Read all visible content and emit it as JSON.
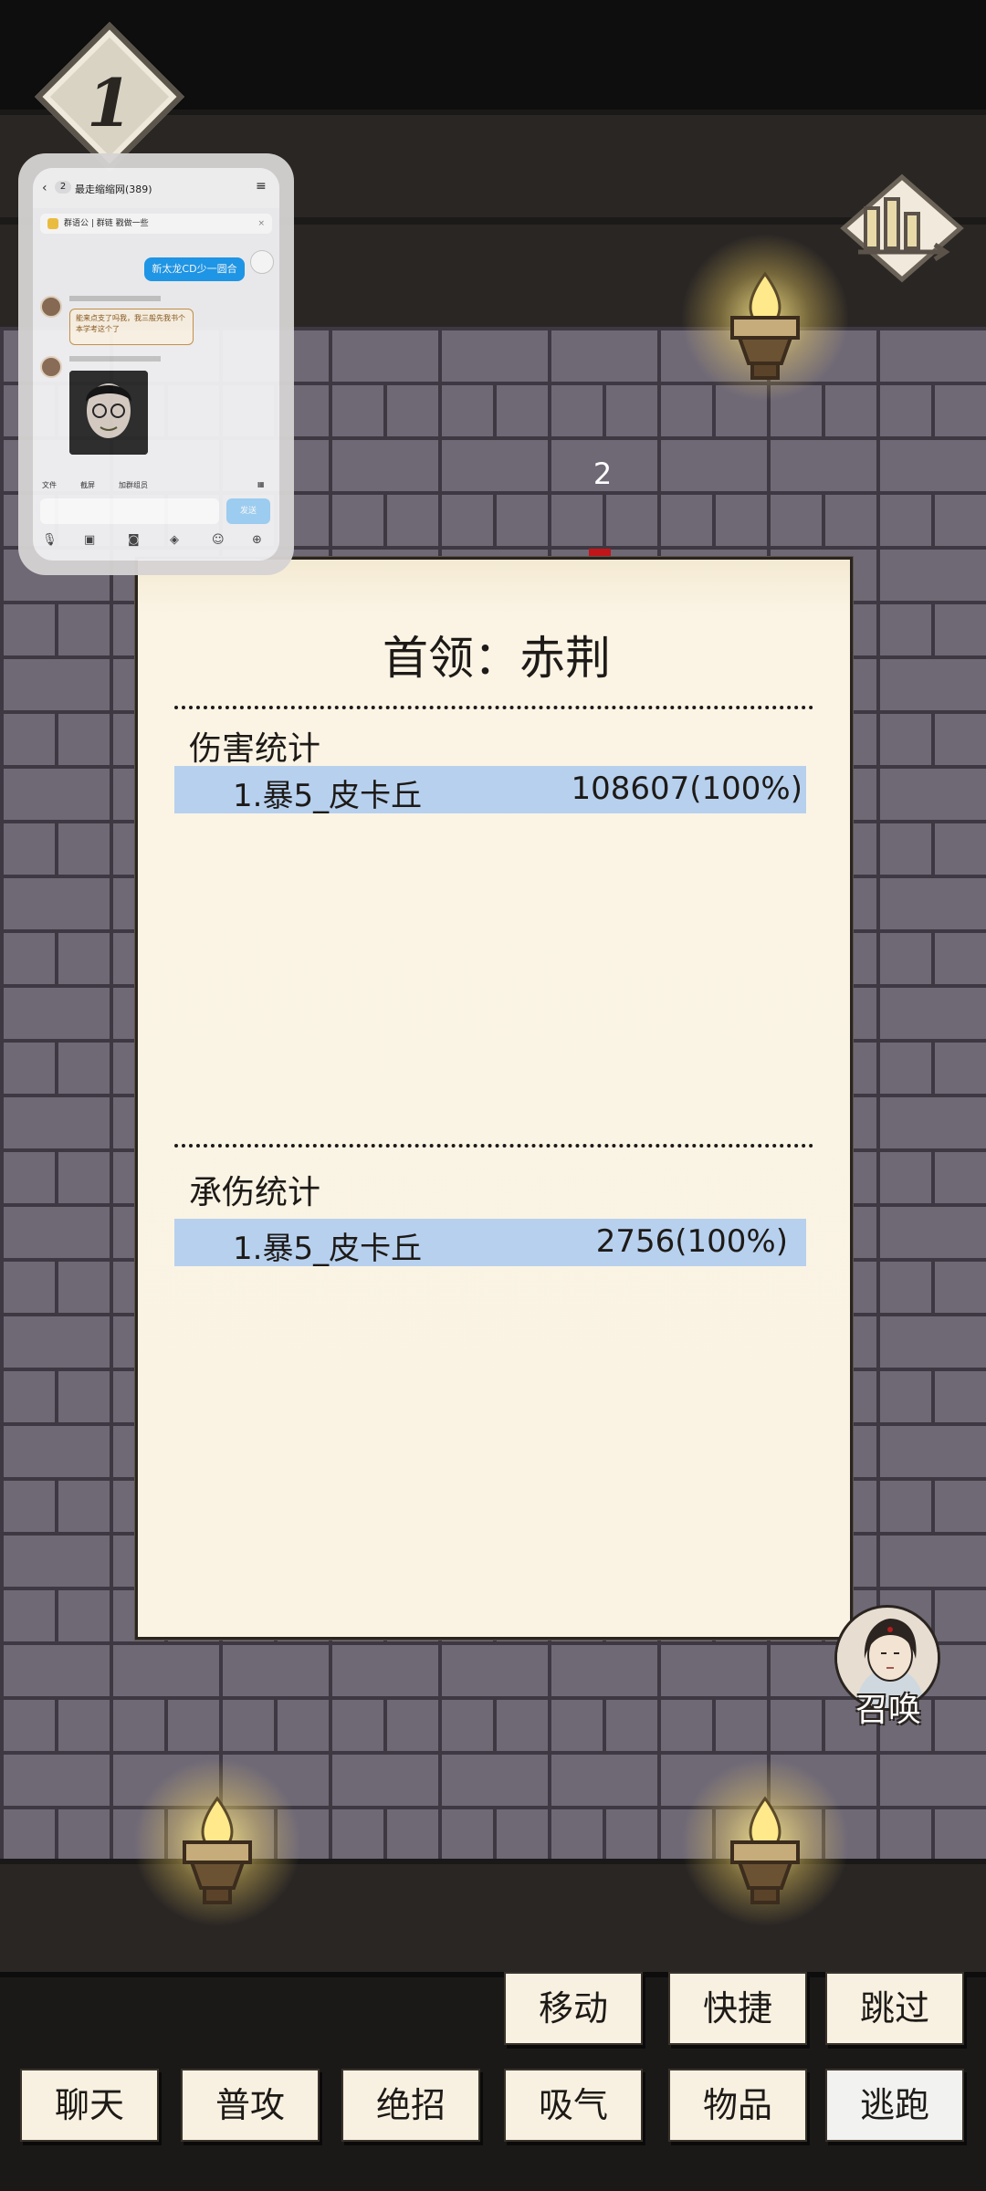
{
  "hud": {
    "floor_number": "1",
    "turn_number": "2",
    "stats_icon": "bar-chart-icon",
    "torch_icon": "torch-icon"
  },
  "chat_overlay": {
    "group_badge": "2",
    "group_title": "最走缩缩网(389)",
    "pinned_text": "群语公 | 群链 戳做一些",
    "my_message": "新太龙CD少一圆合",
    "msg1_text": "能来点支了吗我，我三般先我书个本学考这个了",
    "tools": [
      "文件",
      "截屏",
      "加群组员"
    ],
    "send_label": "发送"
  },
  "report": {
    "boss_title": "首领：赤荆",
    "damage_section": {
      "label": "伤害统计",
      "rows": [
        {
          "name": "1.暴5_皮卡丘",
          "value": "108607(100%)"
        }
      ]
    },
    "taken_section": {
      "label": "承伤统计",
      "rows": [
        {
          "name": "1.暴5_皮卡丘",
          "value": "2756(100%)"
        }
      ]
    }
  },
  "summon": {
    "label": "召唤"
  },
  "actions": {
    "row1": [
      "移动",
      "快捷",
      "跳过"
    ],
    "row2": [
      "聊天",
      "普攻",
      "绝招",
      "吸气",
      "物品",
      "逃跑"
    ]
  }
}
